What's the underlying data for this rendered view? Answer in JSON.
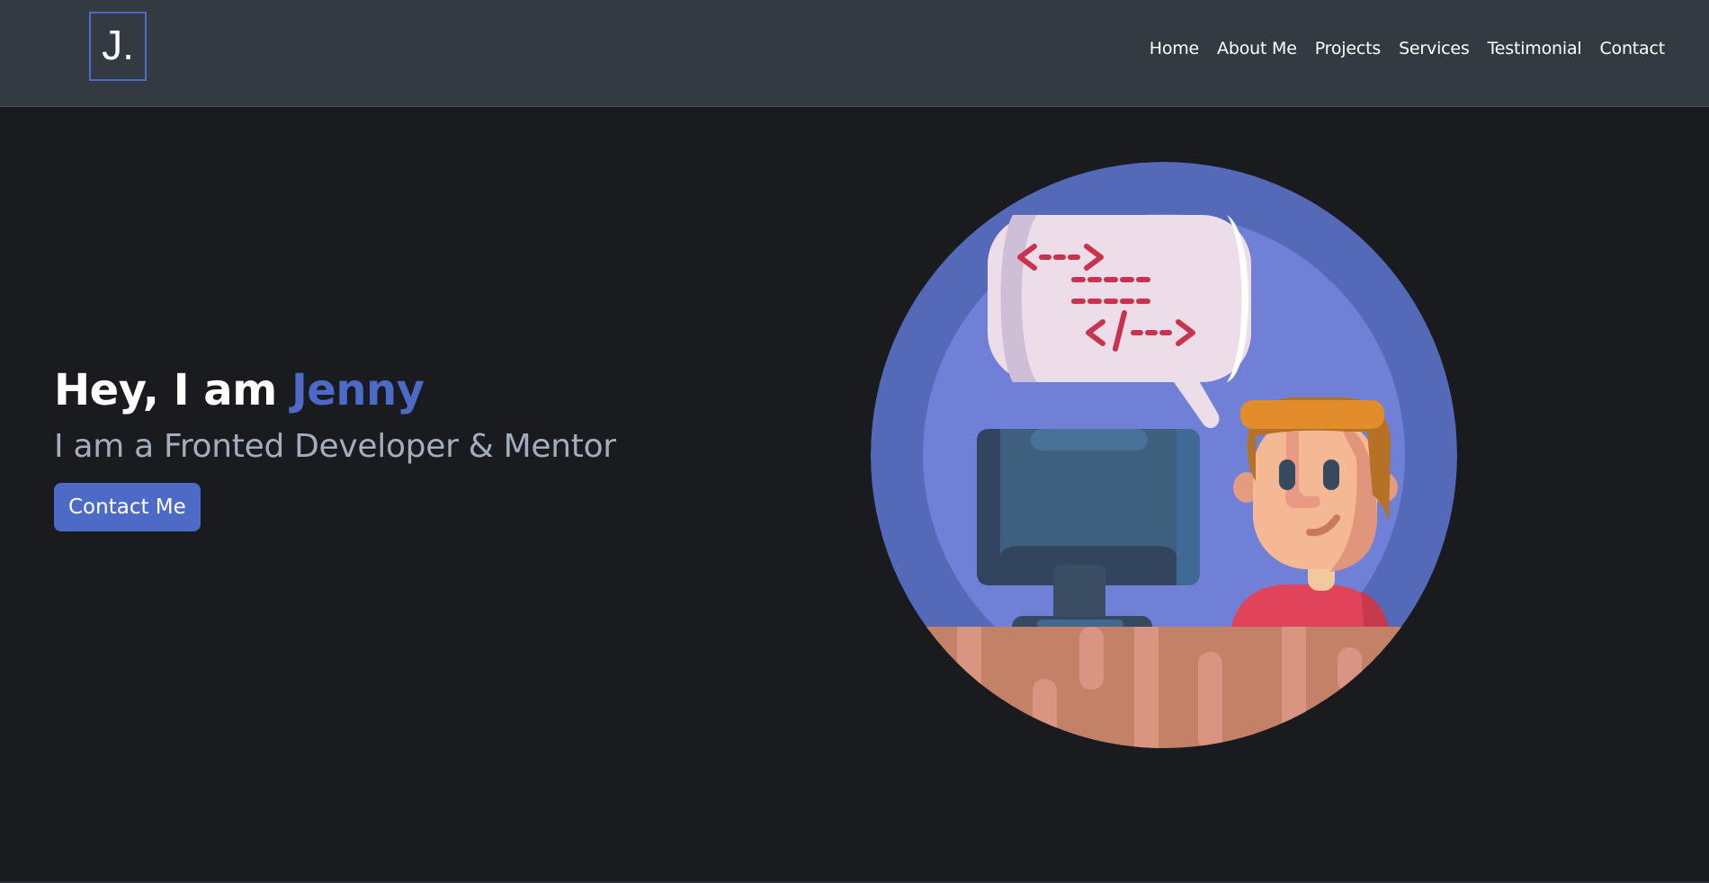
{
  "brand": {
    "logo_text": "J."
  },
  "nav": {
    "items": [
      {
        "label": "Home"
      },
      {
        "label": "About Me"
      },
      {
        "label": "Projects"
      },
      {
        "label": "Services"
      },
      {
        "label": "Testimonial"
      },
      {
        "label": "Contact"
      }
    ]
  },
  "hero": {
    "greeting_prefix": "Hey, I am",
    "name": "Jenny",
    "subtitle": "I am a Fronted Developer & Mentor",
    "cta_label": "Contact Me",
    "illustration": {
      "icon": "developer-at-computer-illustration",
      "code_lines": [
        "<--->",
        "-----",
        "-----",
        "</--->"
      ]
    }
  },
  "colors": {
    "accent": "#4d6bc6",
    "navbar_bg": "#343a42",
    "page_bg": "#1a1b1f",
    "subtitle": "#a3adbb",
    "code_red": "#c7344f"
  }
}
